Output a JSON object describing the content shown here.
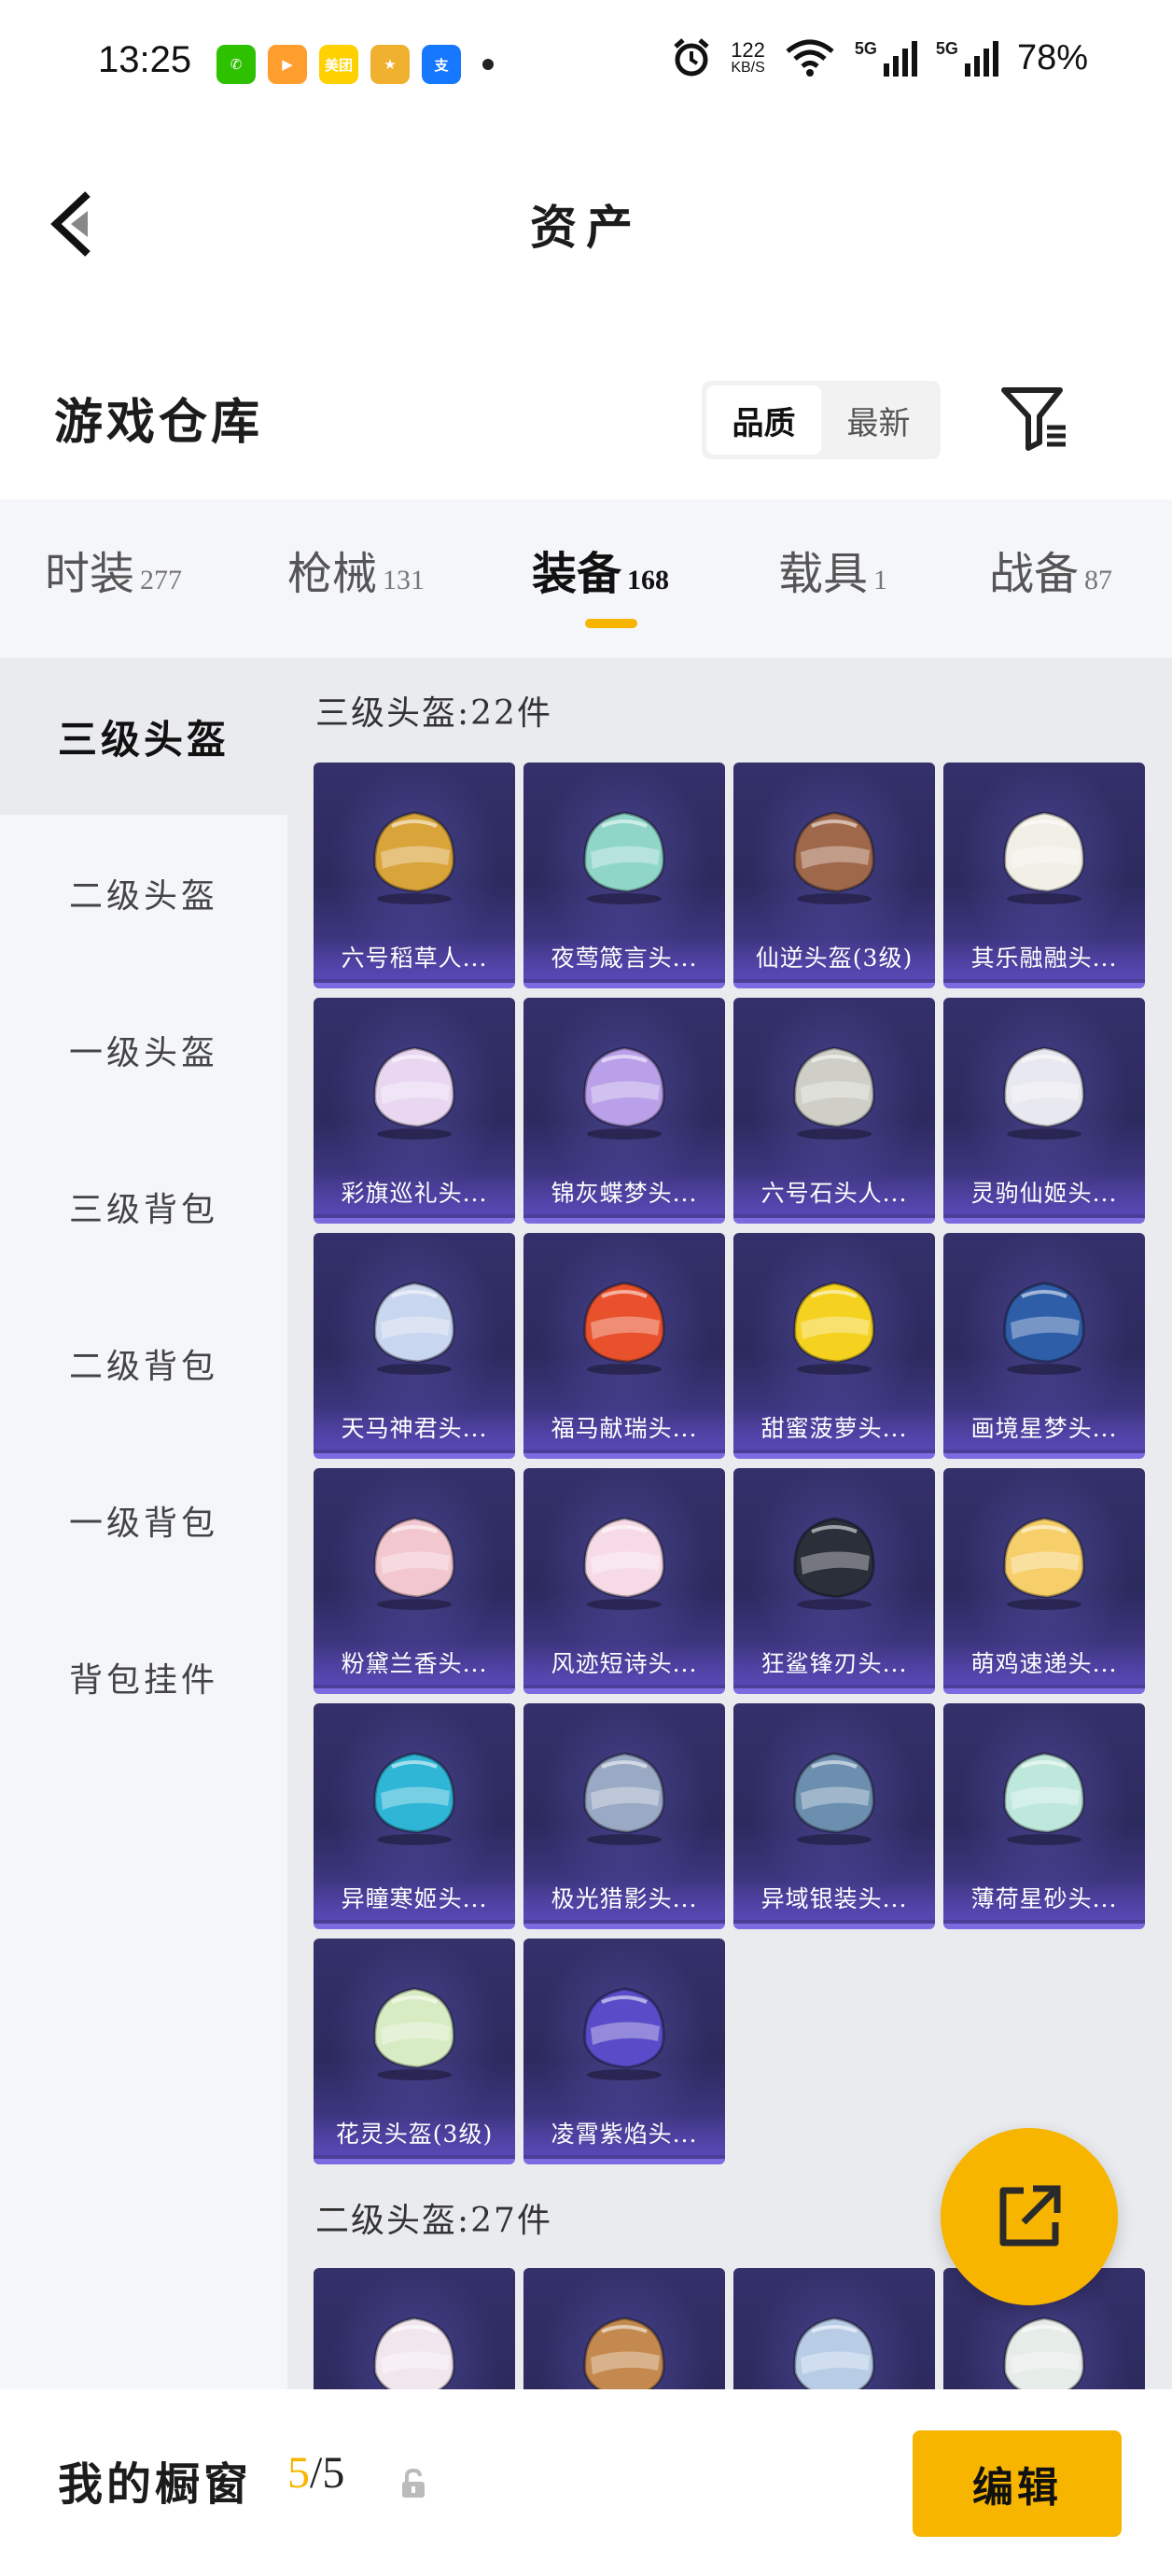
{
  "status_bar": {
    "time": "13:25",
    "apps": [
      {
        "name": "wechat-icon",
        "label": "✆",
        "color": "#2dc100"
      },
      {
        "name": "video-app-icon",
        "label": "▶",
        "color": "#ff9d2e"
      },
      {
        "name": "meituan-icon",
        "label": "美团",
        "color": "#ffd100"
      },
      {
        "name": "game-app-icon",
        "label": "★",
        "color": "#f0b030"
      },
      {
        "name": "alipay-icon",
        "label": "支",
        "color": "#1677ff"
      }
    ],
    "net_speed": "122",
    "net_unit": "KB/S",
    "battery": "78%",
    "sim1": "5G",
    "sim2": "5G"
  },
  "header": {
    "title": "资产"
  },
  "warehouse": {
    "title": "游戏仓库",
    "sort_options": [
      "品质",
      "最新"
    ],
    "active_sort": 0
  },
  "tabs": [
    {
      "label": "时装",
      "count": "277"
    },
    {
      "label": "枪械",
      "count": "131"
    },
    {
      "label": "装备",
      "count": "168"
    },
    {
      "label": "载具",
      "count": "1"
    },
    {
      "label": "战备",
      "count": "87"
    }
  ],
  "sidebar": [
    {
      "label": "三级头盔"
    },
    {
      "label": "二级头盔"
    },
    {
      "label": "一级头盔"
    },
    {
      "label": "三级背包"
    },
    {
      "label": "二级背包"
    },
    {
      "label": "一级背包"
    },
    {
      "label": "背包挂件"
    }
  ],
  "sections": [
    {
      "title": "三级头盔:22件",
      "items": [
        {
          "label": "六号稻草人...",
          "color": "#d9a43a"
        },
        {
          "label": "夜莺箴言头...",
          "color": "#8fd6c9"
        },
        {
          "label": "仙逆头盔(3级)",
          "color": "#a0684a"
        },
        {
          "label": "其乐融融头...",
          "color": "#f2efe6"
        },
        {
          "label": "彩旗巡礼头...",
          "color": "#e9d7f2"
        },
        {
          "label": "锦灰蝶梦头...",
          "color": "#b9a0e8"
        },
        {
          "label": "六号石头人...",
          "color": "#cfcfc8"
        },
        {
          "label": "灵驹仙姬头...",
          "color": "#e8e8f0"
        },
        {
          "label": "天马神君头...",
          "color": "#c9d6ef"
        },
        {
          "label": "福马献瑞头...",
          "color": "#e8512b"
        },
        {
          "label": "甜蜜菠萝头...",
          "color": "#f4d21f"
        },
        {
          "label": "画境星梦头...",
          "color": "#2f5ea8"
        },
        {
          "label": "粉黛兰香头...",
          "color": "#f2c7cf"
        },
        {
          "label": "风迹短诗头...",
          "color": "#f6dbe6"
        },
        {
          "label": "狂鲨锋刃头...",
          "color": "#2a2f3a"
        },
        {
          "label": "萌鸡速递头...",
          "color": "#f6cf6a"
        },
        {
          "label": "异瞳寒姬头...",
          "color": "#2fb6d6"
        },
        {
          "label": "极光猎影头...",
          "color": "#9aa9c4"
        },
        {
          "label": "异域银装头...",
          "color": "#6c8fb0"
        },
        {
          "label": "薄荷星砂头...",
          "color": "#bfe8dc"
        },
        {
          "label": "花灵头盔(3级)",
          "color": "#d7ecc2"
        },
        {
          "label": "凌霄紫焰头...",
          "color": "#5a4cc8"
        }
      ]
    },
    {
      "title": "二级头盔:27件",
      "items": [
        {
          "label": "",
          "color": "#f2e6ee"
        },
        {
          "label": "",
          "color": "#c4894e"
        },
        {
          "label": "",
          "color": "#b8cce6"
        },
        {
          "label": "",
          "color": "#e6ece8"
        }
      ]
    }
  ],
  "showcase": {
    "label": "我的橱窗",
    "current": "5",
    "total": "/5",
    "edit_label": "编辑"
  },
  "colors": {
    "accent": "#f7b500",
    "card_bg": "#2c2a5e"
  }
}
